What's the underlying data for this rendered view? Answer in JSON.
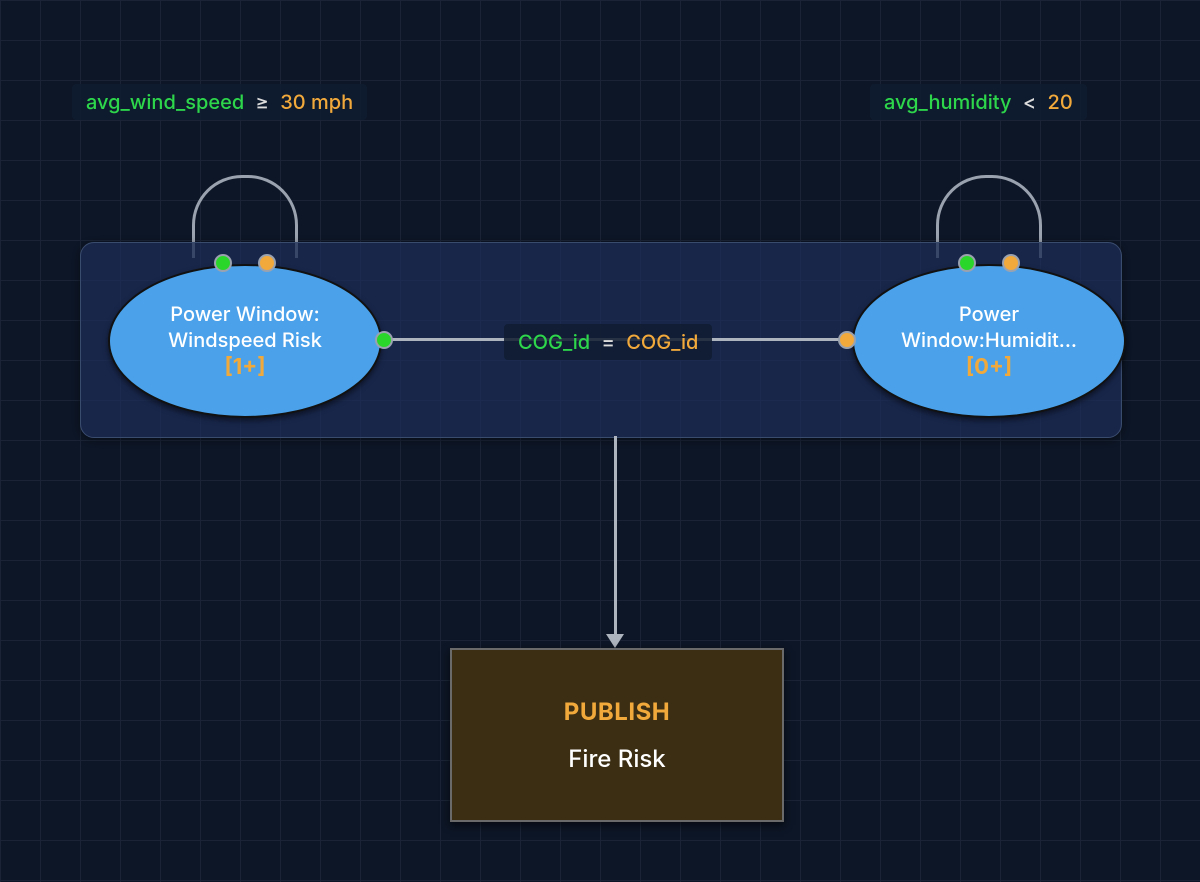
{
  "conditions": {
    "left": {
      "var": "avg_wind_speed",
      "op": "≥",
      "val": "30 mph"
    },
    "right": {
      "var": "avg_humidity",
      "op": "<",
      "val": "20"
    }
  },
  "nodes": {
    "wind": {
      "line1": "Power Window:",
      "line2": "Windspeed Risk",
      "count": "[1+]"
    },
    "humidity": {
      "line1": "Power",
      "line2": "Window:Humidit...",
      "count": "[0+]"
    }
  },
  "join": {
    "left": "COG_id",
    "op": "=",
    "right": "COG_id"
  },
  "publish": {
    "title": "PUBLISH",
    "subtitle": "Fire Risk"
  },
  "colors": {
    "green": "#2bd62b",
    "orange": "#f2a93b",
    "nodeBlue": "#4ba2ea",
    "containerBorder": "#3a4c6e"
  }
}
